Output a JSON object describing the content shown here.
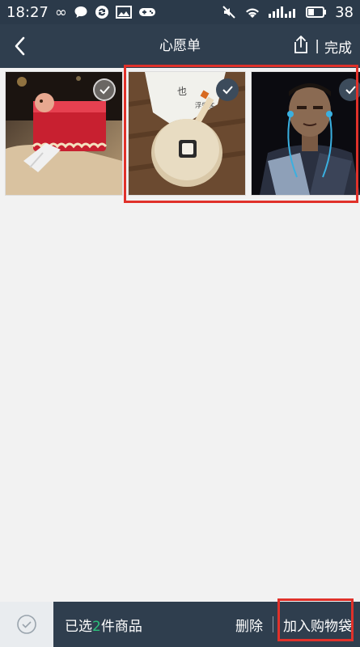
{
  "status_bar": {
    "time": "18:27",
    "battery": "38"
  },
  "nav": {
    "title": "心愿单",
    "done_label": "完成",
    "divider": "|"
  },
  "products": [
    {
      "image": "tissue-box-cover-product-image",
      "selected": false
    },
    {
      "image": "cigarette-ashtray-product-image",
      "selected": true
    },
    {
      "image": "headphones-man-product-image",
      "selected": true
    }
  ],
  "bottom": {
    "selected_prefix": "已选",
    "selected_count": "2",
    "selected_suffix": "件商品",
    "delete_label": "删除",
    "add_to_cart_label": "加入购物袋"
  },
  "colors": {
    "nav_bg": "#2f3e4e",
    "accent_green": "#2bc07a",
    "highlight_red": "#e0312a"
  }
}
